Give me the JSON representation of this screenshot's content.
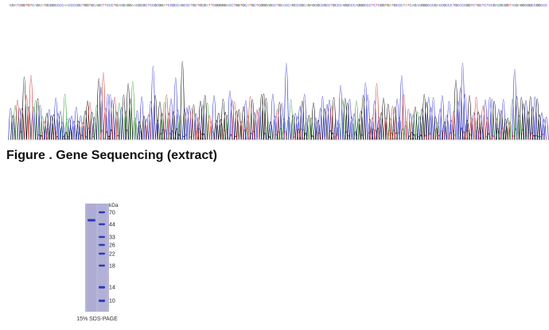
{
  "figure_caption": "Figure . Gene Sequencing (extract)",
  "sequencing": {
    "bases": "CGATCGGTGTCAGCATGCGGCCCCAACCCCGCTGGTGCAGCTTCCCTGACGAGGAACGCGCTCCGCGGATCCGCCAGCCCTGCTGCGATTCGGGGGACCTGGTGCATGCTCGGGAGCCTGCACCAGCCCGCAGAGCGCCGCCTGCCCAGGCCCAGGGCCCTCTCGGTGATGCCCTATCAGACGGGCCCGACCGCCCTGCCCCGGTCTGCTCTCCGACGCGGTACGAGGCGGCCGGCCC",
    "colors": {
      "A": "#2aa02a",
      "C": "#2a2acc",
      "G": "#000000",
      "T": "#cc2a2a"
    }
  },
  "gel": {
    "unit": "kDa",
    "ladder_labels": [
      "70",
      "44",
      "33",
      "26",
      "22",
      "18",
      "14",
      "10"
    ],
    "caption": "15% SDS-PAGE",
    "gel_color": "#b7b5d8",
    "band_color": "#2b3cb0"
  }
}
